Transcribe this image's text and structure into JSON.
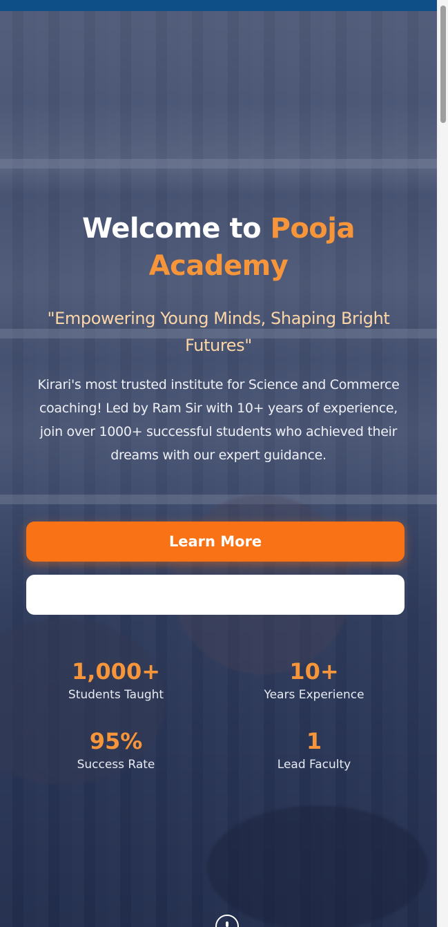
{
  "hero": {
    "title_prefix": "Welcome to ",
    "title_accent": "Pooja Academy",
    "tagline": "\"Empowering Young Minds, Shaping Bright Futures\"",
    "description": "Kirari's most trusted institute for Science and Commerce coaching! Led by Ram Sir with 10+ years of experience, join over 1000+ successful students who achieved their dreams with our expert guidance.",
    "primary_button": "Learn More",
    "secondary_button": ""
  },
  "stats": [
    {
      "value": "1,000+",
      "label": "Students Taught"
    },
    {
      "value": "10+",
      "label": "Years Experience"
    },
    {
      "value": "95%",
      "label": "Success Rate"
    },
    {
      "value": "1",
      "label": "Lead Faculty"
    }
  ],
  "colors": {
    "brand_blue": "#0f4f87",
    "accent_orange": "#f97316",
    "title_accent": "#f7953a",
    "tagline": "#fcd6a6"
  },
  "icons": {
    "scroll_down": "mouse-scroll-icon"
  }
}
